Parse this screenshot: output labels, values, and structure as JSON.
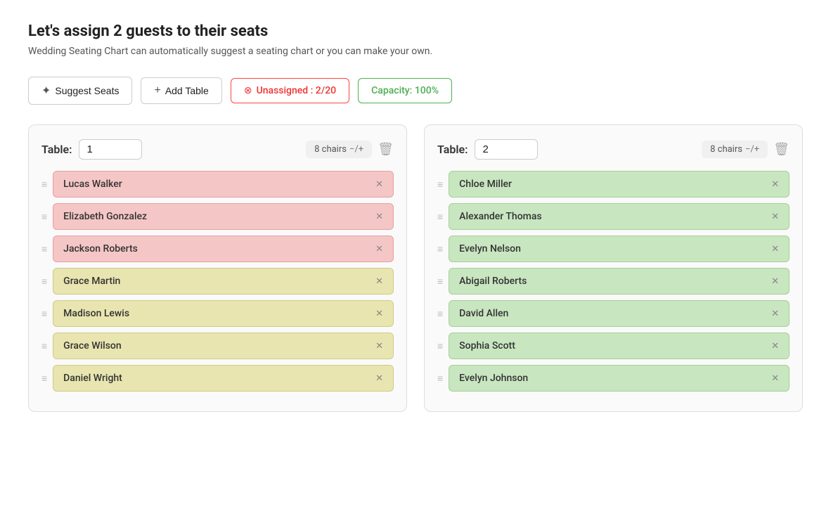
{
  "header": {
    "title": "Let's assign 2 guests to their seats",
    "subtitle": "Wedding Seating Chart can automatically suggest a seating chart or you can make your own."
  },
  "toolbar": {
    "suggest_label": "Suggest Seats",
    "add_label": "Add Table",
    "unassigned_label": "Unassigned : 2/20",
    "capacity_label": "Capacity: 100%"
  },
  "tables": [
    {
      "id": "table-1",
      "label": "Table:",
      "name": "1",
      "chairs": "8 chairs",
      "chairs_adj": "−/+",
      "seats": [
        {
          "name": "Lucas Walker",
          "color": "red"
        },
        {
          "name": "Elizabeth Gonzalez",
          "color": "red"
        },
        {
          "name": "Jackson Roberts",
          "color": "red"
        },
        {
          "name": "Grace Martin",
          "color": "yellow"
        },
        {
          "name": "Madison Lewis",
          "color": "yellow"
        },
        {
          "name": "Grace Wilson",
          "color": "yellow"
        },
        {
          "name": "Daniel Wright",
          "color": "yellow"
        }
      ]
    },
    {
      "id": "table-2",
      "label": "Table:",
      "name": "2",
      "chairs": "8 chairs",
      "chairs_adj": "−/+",
      "seats": [
        {
          "name": "Chloe Miller",
          "color": "green"
        },
        {
          "name": "Alexander Thomas",
          "color": "green"
        },
        {
          "name": "Evelyn Nelson",
          "color": "green"
        },
        {
          "name": "Abigail Roberts",
          "color": "green"
        },
        {
          "name": "David Allen",
          "color": "green"
        },
        {
          "name": "Sophia Scott",
          "color": "green"
        },
        {
          "name": "Evelyn Johnson",
          "color": "green"
        }
      ]
    }
  ]
}
